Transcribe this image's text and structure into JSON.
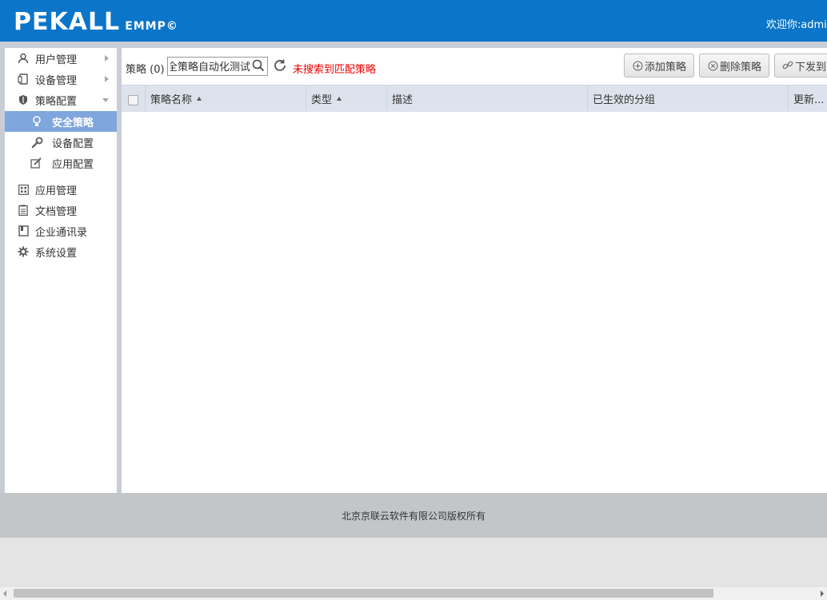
{
  "header": {
    "logo_main": "PEKALL",
    "logo_sub": "EMMP©",
    "welcome": "欢迎你:admin"
  },
  "sidebar": {
    "items": [
      {
        "label": "用户管理",
        "icon": "user-icon"
      },
      {
        "label": "设备管理",
        "icon": "device-icon"
      },
      {
        "label": "策略配置",
        "icon": "shield-icon"
      },
      {
        "label": "应用管理",
        "icon": "apps-grid-icon"
      },
      {
        "label": "文档管理",
        "icon": "document-icon"
      },
      {
        "label": "企业通讯录",
        "icon": "address-book-icon"
      },
      {
        "label": "系统设置",
        "icon": "gear-icon"
      }
    ],
    "subitems": [
      {
        "label": "安全策略",
        "icon": "lightbulb-icon"
      },
      {
        "label": "设备配置",
        "icon": "wrench-icon"
      },
      {
        "label": "应用配置",
        "icon": "edit-icon"
      }
    ]
  },
  "toolbar": {
    "label": "策略",
    "count": "(0)",
    "search_value": "安全策略自动化测试",
    "no_result": "未搜索到匹配策略",
    "add_label": "添加策略",
    "delete_label": "删除策略",
    "dispatch_label": "下发到"
  },
  "table": {
    "columns": [
      "策略名称",
      "类型",
      "描述",
      "已生效的分组",
      "更新..."
    ]
  },
  "footer": {
    "copyright": "北京京联云软件有限公司版权所有"
  },
  "colors": {
    "header_bg": "#0a75c9",
    "active_nav_bg": "#7fa6dd",
    "error_text": "#ee0000"
  }
}
